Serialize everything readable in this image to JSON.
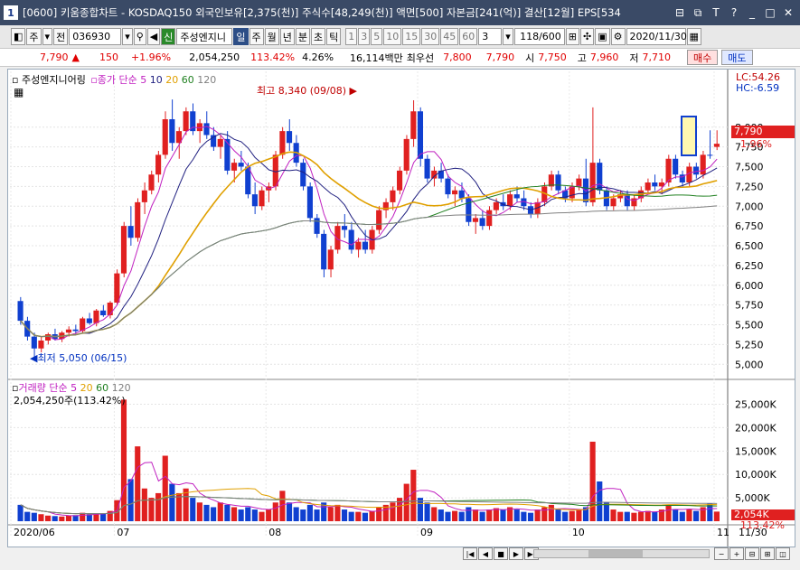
{
  "title": {
    "num": "1",
    "text": "[0600] 키움종합차트 - KOSDAQ150 외국인보유[2,375(천)] 주식수[48,249(천)] 액면[500] 자본금[241(억)] 결산[12월] EPS[534"
  },
  "toolbar": {
    "mode": "주",
    "prefix": "전",
    "code": "036930",
    "new_badge": "신",
    "name": "주성엔지니",
    "periods": [
      "일",
      "주",
      "월",
      "년",
      "분",
      "초",
      "틱"
    ],
    "minutes": [
      "1",
      "3",
      "5",
      "10",
      "15",
      "30",
      "45",
      "60"
    ],
    "count_sel": "3",
    "range": "118/600",
    "date": "2020/11/30"
  },
  "quote": {
    "price": "7,790",
    "change": "150",
    "pct": "+1.96%",
    "volume": "2,054,250",
    "vol_pct": "113.42%",
    "turnover": "4.26%",
    "amount": "16,114백만",
    "bid_label": "최우선",
    "bid1": "7,800",
    "bid2": "7,790",
    "open_label": "시",
    "open": "7,750",
    "high_label": "고",
    "high": "7,960",
    "low_label": "저",
    "low": "7,710",
    "buy": "매수",
    "sell": "매도"
  },
  "price_panel": {
    "name": "주성엔지니어링",
    "legend_label": "종가 단순",
    "ma": [
      "5",
      "10",
      "20",
      "60",
      "120"
    ],
    "lc": "LC:54.26",
    "hc": "HC:-6.59",
    "high_note": "최고 8,340 (09/08)",
    "low_note": "최저 5,050 (06/15)",
    "cur_price": "7,790",
    "cur_pct": "1.96%",
    "yticks": [
      "8,000",
      "7,750",
      "7,500",
      "7,250",
      "7,000",
      "6,750",
      "6,500",
      "6,250",
      "6,000",
      "5,750",
      "5,500",
      "5,250",
      "5,000"
    ]
  },
  "volume_panel": {
    "legend_label": "거래량 단순",
    "ma": [
      "5",
      "20",
      "60",
      "120"
    ],
    "info": "2,054,250주(113.42%)",
    "yticks": [
      "25,000K",
      "20,000K",
      "15,000K",
      "10,000K",
      "5,000K"
    ],
    "cur_vol": "2,054K",
    "cur_pct": "113.42%"
  },
  "xaxis": {
    "labels": [
      "2020/06",
      "07",
      "08",
      "09",
      "10",
      "11"
    ],
    "end_label": "11/30"
  },
  "colors": {
    "up": "#e02020",
    "down": "#1040d0",
    "ma5": "#c020c0",
    "ma10": "#202080",
    "ma20": "#e0a000",
    "ma60": "#208020",
    "ma120": "#808080"
  },
  "chart_data": {
    "type": "candlestick",
    "ylim": [
      4900,
      8500
    ],
    "ohlc": [
      [
        5800,
        5850,
        5500,
        5550
      ],
      [
        5550,
        5600,
        5300,
        5350
      ],
      [
        5350,
        5400,
        5050,
        5200
      ],
      [
        5200,
        5350,
        5150,
        5300
      ],
      [
        5300,
        5400,
        5250,
        5380
      ],
      [
        5380,
        5450,
        5300,
        5320
      ],
      [
        5320,
        5420,
        5280,
        5400
      ],
      [
        5400,
        5480,
        5350,
        5440
      ],
      [
        5440,
        5500,
        5380,
        5420
      ],
      [
        5420,
        5600,
        5400,
        5580
      ],
      [
        5580,
        5650,
        5500,
        5520
      ],
      [
        5520,
        5700,
        5480,
        5680
      ],
      [
        5680,
        5750,
        5600,
        5620
      ],
      [
        5620,
        5800,
        5580,
        5780
      ],
      [
        5780,
        6200,
        5750,
        6150
      ],
      [
        6150,
        6800,
        6100,
        6750
      ],
      [
        6750,
        7000,
        6500,
        6600
      ],
      [
        6600,
        7100,
        6550,
        7050
      ],
      [
        7050,
        7300,
        6900,
        7200
      ],
      [
        7200,
        7450,
        7150,
        7400
      ],
      [
        7400,
        7700,
        7300,
        7650
      ],
      [
        7650,
        8200,
        7600,
        8100
      ],
      [
        8100,
        8350,
        7700,
        7800
      ],
      [
        7800,
        8000,
        7600,
        7950
      ],
      [
        7950,
        8250,
        7900,
        8200
      ],
      [
        8200,
        8300,
        7900,
        7950
      ],
      [
        7950,
        8100,
        7800,
        8050
      ],
      [
        8050,
        8200,
        7850,
        7900
      ],
      [
        7900,
        8000,
        7700,
        7750
      ],
      [
        7750,
        7900,
        7600,
        7850
      ],
      [
        7850,
        7950,
        7400,
        7450
      ],
      [
        7450,
        7600,
        7300,
        7550
      ],
      [
        7550,
        7700,
        7450,
        7500
      ],
      [
        7500,
        7550,
        7100,
        7150
      ],
      [
        7150,
        7300,
        6900,
        7000
      ],
      [
        7000,
        7250,
        6950,
        7200
      ],
      [
        7200,
        7300,
        7050,
        7250
      ],
      [
        7250,
        7700,
        7200,
        7650
      ],
      [
        7650,
        8000,
        7600,
        7950
      ],
      [
        7950,
        8100,
        7700,
        7800
      ],
      [
        7800,
        7900,
        7500,
        7550
      ],
      [
        7550,
        7600,
        7200,
        7250
      ],
      [
        7250,
        7300,
        6800,
        6850
      ],
      [
        6850,
        6900,
        6600,
        6650
      ],
      [
        6650,
        6700,
        6100,
        6200
      ],
      [
        6200,
        6500,
        6100,
        6450
      ],
      [
        6450,
        6800,
        6400,
        6750
      ],
      [
        6750,
        6900,
        6600,
        6700
      ],
      [
        6700,
        6800,
        6400,
        6450
      ],
      [
        6450,
        6600,
        6350,
        6550
      ],
      [
        6550,
        6700,
        6400,
        6450
      ],
      [
        6450,
        6750,
        6400,
        6700
      ],
      [
        6700,
        7000,
        6650,
        6950
      ],
      [
        6950,
        7100,
        6850,
        7050
      ],
      [
        7050,
        7250,
        6950,
        7200
      ],
      [
        7200,
        7500,
        7150,
        7450
      ],
      [
        7450,
        7900,
        7400,
        7850
      ],
      [
        7850,
        8340,
        7750,
        8200
      ],
      [
        8200,
        8250,
        7500,
        7600
      ],
      [
        7600,
        7650,
        7300,
        7350
      ],
      [
        7350,
        7500,
        7250,
        7450
      ],
      [
        7450,
        7550,
        7300,
        7350
      ],
      [
        7350,
        7400,
        7100,
        7150
      ],
      [
        7150,
        7250,
        7000,
        7200
      ],
      [
        7200,
        7300,
        7050,
        7100
      ],
      [
        7100,
        7150,
        6750,
        6800
      ],
      [
        6800,
        6900,
        6650,
        6850
      ],
      [
        6850,
        6950,
        6700,
        6750
      ],
      [
        6750,
        7000,
        6700,
        6950
      ],
      [
        6950,
        7100,
        6900,
        7050
      ],
      [
        7050,
        7150,
        6950,
        7000
      ],
      [
        7000,
        7200,
        6950,
        7150
      ],
      [
        7150,
        7250,
        7050,
        7100
      ],
      [
        7100,
        7200,
        6950,
        7000
      ],
      [
        7000,
        7050,
        6850,
        6900
      ],
      [
        6900,
        7100,
        6850,
        7050
      ],
      [
        7050,
        7300,
        7000,
        7250
      ],
      [
        7250,
        7450,
        7200,
        7400
      ],
      [
        7400,
        7450,
        7150,
        7200
      ],
      [
        7200,
        7250,
        7050,
        7100
      ],
      [
        7100,
        7300,
        7050,
        7250
      ],
      [
        7250,
        7400,
        7200,
        7350
      ],
      [
        7350,
        7600,
        7000,
        7050
      ],
      [
        7050,
        8250,
        7000,
        7550
      ],
      [
        7550,
        7600,
        7150,
        7200
      ],
      [
        7200,
        7250,
        6950,
        7000
      ],
      [
        7000,
        7150,
        6950,
        7100
      ],
      [
        7100,
        7200,
        7050,
        7150
      ],
      [
        7150,
        7200,
        6950,
        7000
      ],
      [
        7000,
        7150,
        6950,
        7100
      ],
      [
        7100,
        7250,
        7050,
        7200
      ],
      [
        7200,
        7350,
        7150,
        7300
      ],
      [
        7300,
        7400,
        7200,
        7250
      ],
      [
        7250,
        7350,
        7150,
        7300
      ],
      [
        7300,
        7650,
        7250,
        7600
      ],
      [
        7600,
        7650,
        7350,
        7400
      ],
      [
        7400,
        7450,
        7250,
        7300
      ],
      [
        7300,
        7550,
        7250,
        7500
      ],
      [
        7500,
        7550,
        7350,
        7400
      ],
      [
        7400,
        7700,
        7350,
        7650
      ],
      [
        7650,
        7960,
        7600,
        7640
      ],
      [
        7750,
        7960,
        7710,
        7790
      ]
    ],
    "volume": [
      3500,
      2000,
      1800,
      1500,
      1200,
      1100,
      1000,
      1200,
      1300,
      1800,
      1500,
      1700,
      1600,
      2200,
      4500,
      26000,
      9000,
      16000,
      7000,
      5000,
      6000,
      14000,
      8000,
      6000,
      7000,
      5000,
      4000,
      3500,
      3000,
      4000,
      3500,
      3000,
      2500,
      3000,
      2500,
      2000,
      2500,
      4000,
      6500,
      4000,
      3000,
      2500,
      3500,
      2500,
      4000,
      3000,
      3500,
      2500,
      2000,
      2000,
      1800,
      2200,
      3000,
      3500,
      4000,
      5000,
      8000,
      11000,
      5000,
      4000,
      3000,
      2500,
      2000,
      2200,
      2000,
      3000,
      2500,
      2000,
      2500,
      2800,
      2500,
      3000,
      2500,
      2000,
      1800,
      2500,
      3000,
      3500,
      2500,
      2000,
      2200,
      2500,
      3000,
      17000,
      8500,
      4000,
      2500,
      2000,
      2000,
      1800,
      2000,
      2200,
      2000,
      2500,
      3500,
      2500,
      2000,
      2500,
      2200,
      3000,
      3800,
      2054
    ]
  }
}
